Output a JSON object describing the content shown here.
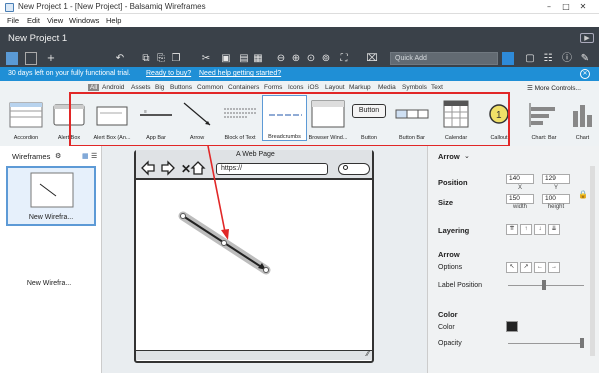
{
  "window": {
    "title": "New Project 1 - [New Project] - Balsamiq Wireframes"
  },
  "menu": [
    "File",
    "Edit",
    "View",
    "Windows",
    "Help"
  ],
  "project": {
    "title": "New Project 1"
  },
  "toolbar": {
    "quick_add_placeholder": "Quick Add"
  },
  "trial": {
    "message": "30 days left on your fully functional trial.",
    "buy_link": "Ready to buy?",
    "help_link": "Need help getting started?"
  },
  "library": {
    "categories": [
      "All",
      "Android",
      "Assets",
      "Big",
      "Buttons",
      "Common",
      "Containers",
      "Forms",
      "Icons",
      "iOS",
      "Layout",
      "Markup",
      "Media",
      "Symbols",
      "Text"
    ],
    "more_controls": "More Controls...",
    "items": [
      "Accordion",
      "Alert Box",
      "Alert Box (An...",
      "App Bar",
      "Arrow",
      "Block of Text",
      "Breadcrumbs",
      "Browser Wind...",
      "Button",
      "Button Bar",
      "Calendar",
      "Callout",
      "Chart: Bar",
      "Chart"
    ],
    "button_thumb_text": "Button"
  },
  "wireframes_panel": {
    "title": "Wireframes",
    "items": [
      "New Wirefra...",
      "New Wirefra..."
    ]
  },
  "mockup": {
    "title": "A Web Page",
    "url": "https://"
  },
  "properties": {
    "title": "Arrow",
    "position_label": "Position",
    "x": "140",
    "y": "129",
    "x_label": "X",
    "y_label": "Y",
    "size_label": "Size",
    "width": "150",
    "height": "100",
    "width_label": "width",
    "height_label": "height",
    "layering_label": "Layering",
    "arrow_section": "Arrow",
    "options_label": "Options",
    "label_position_label": "Label Position",
    "color_section": "Color",
    "color_label": "Color",
    "opacity_label": "Opacity",
    "color_value": "#222222"
  },
  "annotation_color": "#e12727"
}
